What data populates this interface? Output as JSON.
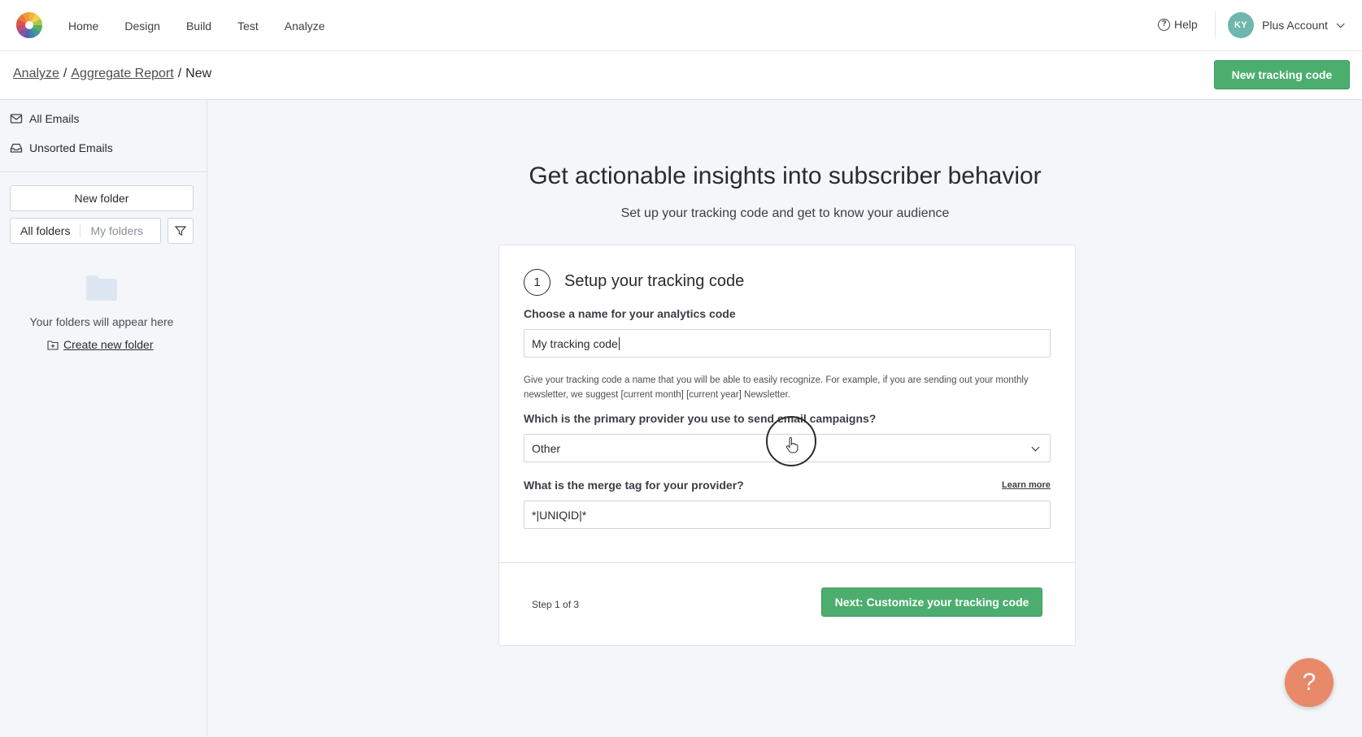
{
  "nav": {
    "items": [
      "Home",
      "Design",
      "Build",
      "Test",
      "Analyze"
    ],
    "help_label": "Help",
    "avatar_initials": "KY",
    "account_label": "Plus Account"
  },
  "breadcrumb": {
    "part1": "Analyze",
    "part2": "Aggregate Report",
    "current": "New",
    "separator": "/"
  },
  "header_button": "New tracking code",
  "sidebar": {
    "all_emails": "All Emails",
    "unsorted_emails": "Unsorted Emails",
    "new_folder": "New folder",
    "all_folders": "All folders",
    "my_folders": "My folders",
    "empty_text": "Your folders will appear here",
    "create_folder": "Create new folder"
  },
  "main": {
    "headline": "Get actionable insights into subscriber behavior",
    "subline": "Set up your tracking code and get to know your audience"
  },
  "card": {
    "step_number": "1",
    "title": "Setup your tracking code",
    "name_label": "Choose a name for your analytics code",
    "name_value": "My tracking code",
    "name_help": "Give your tracking code a name that you will be able to easily recognize. For example, if you are sending out your monthly newsletter, we suggest [current month] [current year] Newsletter.",
    "provider_label": "Which is the primary provider you use to send email campaigns?",
    "provider_value": "Other",
    "merge_label": "What is the merge tag for your provider?",
    "learn_more": "Learn more",
    "merge_value": "*|UNIQID|*",
    "step_count": "Step 1 of 3",
    "next_button": "Next: Customize your tracking code"
  },
  "fab_label": "?",
  "colors": {
    "accent_green": "#4cae6e",
    "avatar": "#6fb6ac",
    "fab": "#e8896a"
  }
}
